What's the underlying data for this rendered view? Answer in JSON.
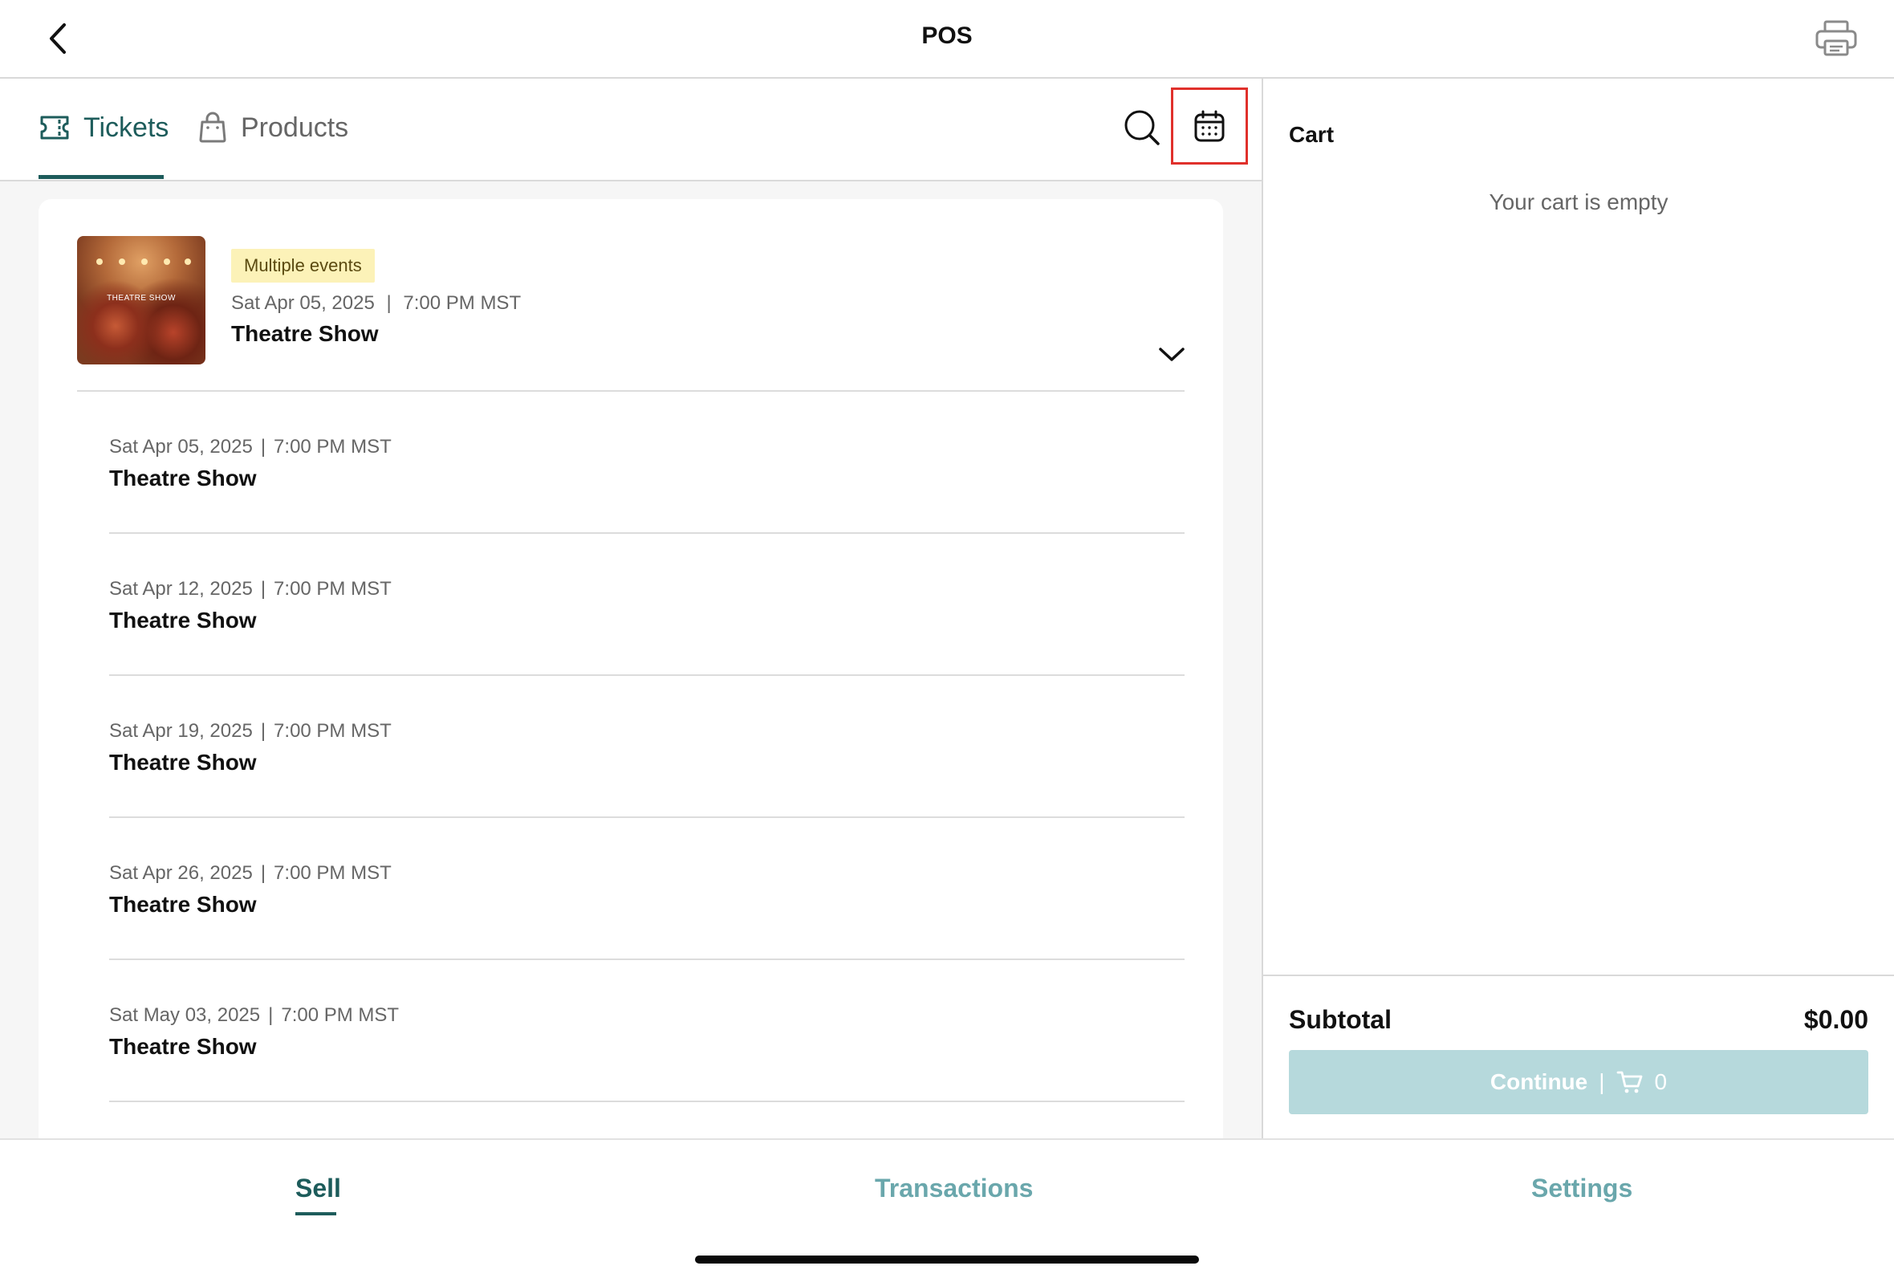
{
  "header": {
    "title": "POS",
    "back_icon": "chevron-left-icon",
    "print_icon": "printer-icon"
  },
  "tabs": [
    {
      "label": "Tickets",
      "icon": "ticket-icon",
      "active": true
    },
    {
      "label": "Products",
      "icon": "shopping-bag-icon",
      "active": false
    }
  ],
  "toolbar": {
    "search_icon": "search-icon",
    "calendar_icon": "calendar-icon"
  },
  "event_group": {
    "badge": "Multiple events",
    "date": "Sat Apr 05, 2025",
    "time": "7:00 PM MST",
    "separator": "|",
    "title": "Theatre Show",
    "thumbnail_text": "THEATRE SHOW",
    "expand_icon": "chevron-down-icon"
  },
  "events": [
    {
      "date": "Sat Apr 05, 2025",
      "time": "7:00 PM MST",
      "title": "Theatre Show"
    },
    {
      "date": "Sat Apr 12, 2025",
      "time": "7:00 PM MST",
      "title": "Theatre Show"
    },
    {
      "date": "Sat Apr 19, 2025",
      "time": "7:00 PM MST",
      "title": "Theatre Show"
    },
    {
      "date": "Sat Apr 26, 2025",
      "time": "7:00 PM MST",
      "title": "Theatre Show"
    },
    {
      "date": "Sat May 03, 2025",
      "time": "7:00 PM MST",
      "title": "Theatre Show"
    }
  ],
  "cart": {
    "title": "Cart",
    "empty_message": "Your cart is empty",
    "subtotal_label": "Subtotal",
    "subtotal_value": "$0.00",
    "continue_label": "Continue",
    "separator": "|",
    "cart_icon": "cart-icon",
    "count": "0"
  },
  "bottom_nav": [
    {
      "label": "Sell",
      "active": true
    },
    {
      "label": "Transactions",
      "active": false
    },
    {
      "label": "Settings",
      "active": false
    }
  ],
  "colors": {
    "accent": "#1d5c5b",
    "inactive_nav": "#6aa7ac",
    "badge_bg": "#fcf2b8",
    "continue_bg": "#b6d9dc",
    "highlight_box": "#e0302b"
  }
}
